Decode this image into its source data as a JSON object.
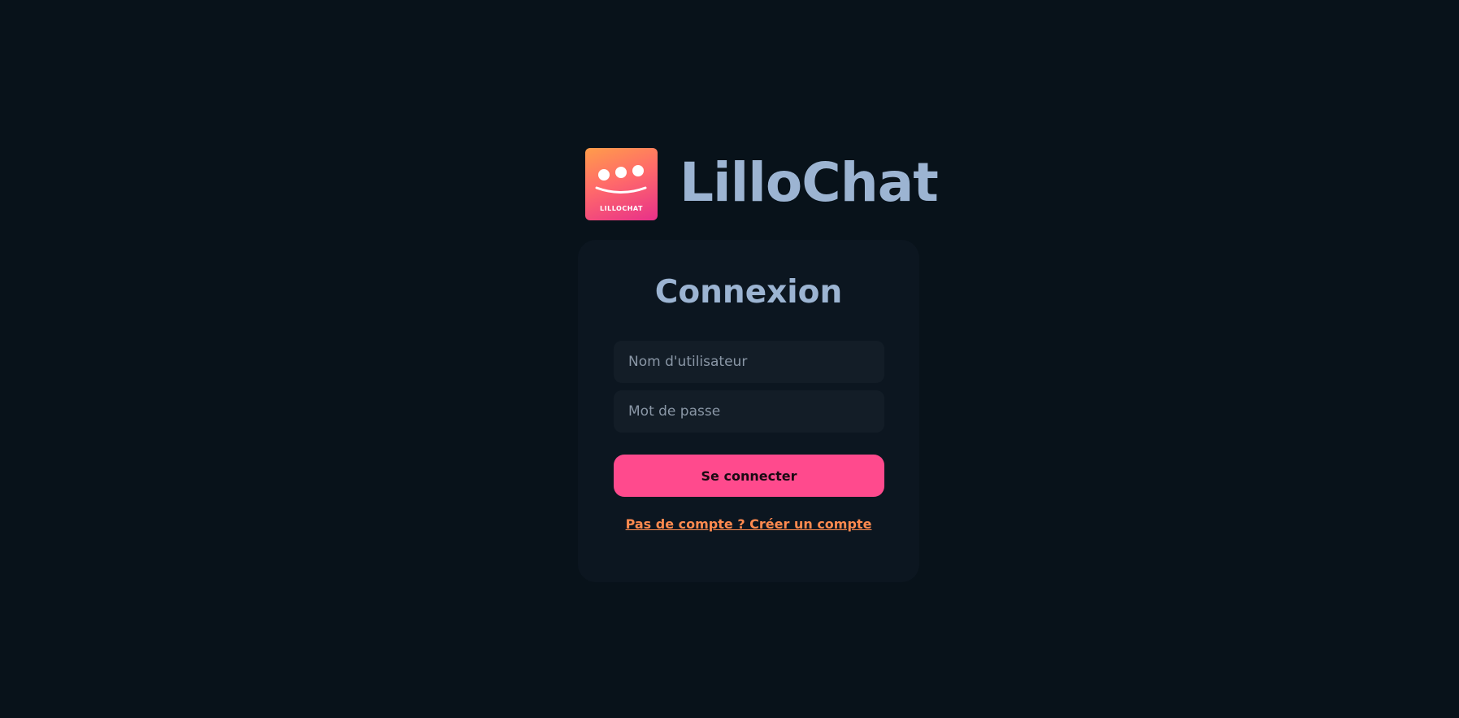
{
  "app": {
    "name": "LilloChat",
    "logo_text": "LILLOCHAT"
  },
  "login": {
    "title": "Connexion",
    "username_placeholder": "Nom d'utilisateur",
    "username_value": "",
    "password_placeholder": "Mot de passe",
    "password_value": "",
    "submit_label": "Se connecter",
    "signup_link": "Pas de compte ? Créer un compte"
  },
  "colors": {
    "background": "#08121a",
    "card": "#0c1620",
    "accent": "#ff4a8d",
    "link": "#ff8a4f",
    "heading": "#9cb4d2"
  },
  "icons": {
    "logo": "smiley-chat-icon"
  }
}
